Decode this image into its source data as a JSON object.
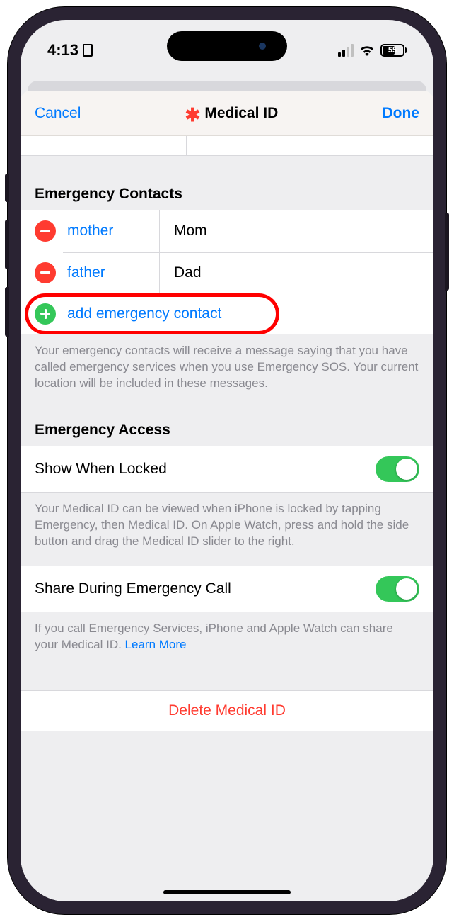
{
  "status": {
    "time": "4:13",
    "battery": "55"
  },
  "nav": {
    "cancel": "Cancel",
    "title": "Medical ID",
    "done": "Done"
  },
  "sections": {
    "emergency_contacts": {
      "header": "Emergency Contacts",
      "contacts": [
        {
          "relation": "mother",
          "name": "Mom"
        },
        {
          "relation": "father",
          "name": "Dad"
        }
      ],
      "add_label": "add emergency contact",
      "footer": "Your emergency contacts will receive a message saying that you have called emergency services when you use Emergency SOS. Your current location will be included in these messages."
    },
    "emergency_access": {
      "header": "Emergency Access",
      "show_locked": {
        "label": "Show When Locked",
        "footer": "Your Medical ID can be viewed when iPhone is locked by tapping Emergency, then Medical ID. On Apple Watch, press and hold the side button and drag the Medical ID slider to the right."
      },
      "share_call": {
        "label": "Share During Emergency Call",
        "footer": "If you call Emergency Services, iPhone and Apple Watch can share your Medical ID. ",
        "learn_more": "Learn More"
      }
    }
  },
  "delete_label": "Delete Medical ID"
}
